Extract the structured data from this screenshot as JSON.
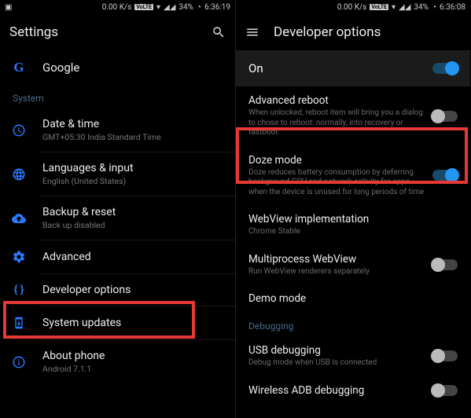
{
  "left": {
    "status": {
      "speed": "0.00 K/s",
      "volte": "VoLTE",
      "signal": "▾◢◢",
      "battery": "34%",
      "time": "6:36:19"
    },
    "header": {
      "title": "Settings"
    },
    "google": {
      "label": "Google"
    },
    "sectionSystem": "System",
    "items": [
      {
        "label": "Date & time",
        "sub": "GMT+05:30 India Standard Time"
      },
      {
        "label": "Languages & input",
        "sub": "English (United States)"
      },
      {
        "label": "Backup & reset",
        "sub": "Back up disabled"
      },
      {
        "label": "Advanced",
        "sub": ""
      },
      {
        "label": "Developer options",
        "sub": ""
      },
      {
        "label": "System updates",
        "sub": ""
      },
      {
        "label": "About phone",
        "sub": "Android 7.1.1"
      }
    ]
  },
  "right": {
    "status": {
      "speed": "0.00 K/s",
      "volte": "VoLTE",
      "signal": "▾◢◢",
      "battery": "34%",
      "time": "6:36:08"
    },
    "header": {
      "title": "Developer options"
    },
    "onbar": {
      "label": "On"
    },
    "items": [
      {
        "label": "Advanced reboot",
        "sub": "When unlocked, reboot item will bring you a dialog to chose to reboot: normally, into recovery or fastboot"
      },
      {
        "label": "Doze mode",
        "sub": "Doze reduces battery consumption by deferring background CPU and network activity for apps when the device is unused for long periods of time"
      },
      {
        "label": "WebView implementation",
        "sub": "Chrome Stable"
      },
      {
        "label": "Multiprocess WebView",
        "sub": "Run WebView renderers separately"
      },
      {
        "label": "Demo mode",
        "sub": ""
      }
    ],
    "sectionDebug": "Debugging",
    "debugItems": [
      {
        "label": "USB debugging",
        "sub": "Debug mode when USB is connected"
      },
      {
        "label": "Wireless ADB debugging",
        "sub": ""
      }
    ]
  }
}
